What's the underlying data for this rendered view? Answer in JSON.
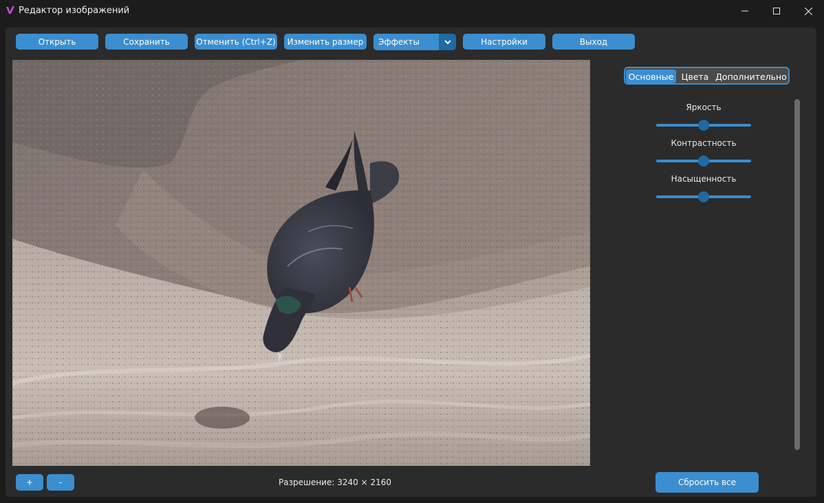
{
  "window": {
    "title": "Редактор изображений",
    "accent_color": "#3b8ed0",
    "accent_dark_color": "#1f6aa5",
    "background_color": "#2b2b2b"
  },
  "toolbar": {
    "open_label": "Открыть",
    "save_label": "Сохранить",
    "undo_label": "Отменить (Ctrl+Z)",
    "resize_label": "Изменить размер",
    "effects_value": "Эффекты",
    "settings_label": "Настройки",
    "exit_label": "Выход"
  },
  "tabs": {
    "basic": "Основные",
    "colors": "Цвета",
    "advanced": "Дополнительно",
    "selected": "Основные"
  },
  "sliders": {
    "brightness": {
      "label": "Яркость",
      "value": 0.5
    },
    "contrast": {
      "label": "Контрастность",
      "value": 0.5
    },
    "saturation": {
      "label": "Насыщенность",
      "value": 0.5
    }
  },
  "bottom": {
    "zoom_in_label": "+",
    "zoom_out_label": "-",
    "resolution_text": "Разрешение: 3240 × 2160",
    "reset_label": "Сбросить все"
  },
  "icons": {
    "app": "app-logo-icon",
    "minimize": "minimize-icon",
    "maximize": "maximize-icon",
    "close": "close-icon",
    "dropdown": "chevron-down-icon"
  }
}
